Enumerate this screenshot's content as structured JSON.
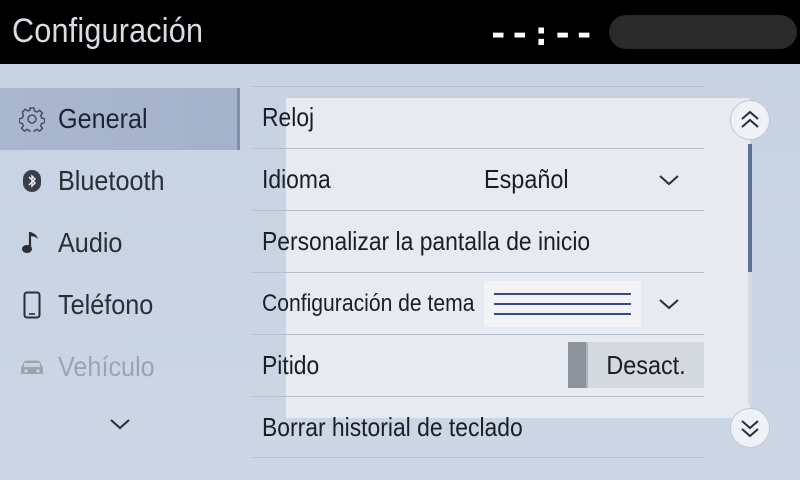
{
  "header": {
    "title": "Configuración",
    "clock": "--:--"
  },
  "sidebar": {
    "items": [
      {
        "label": "General",
        "icon": "gear-icon",
        "active": true
      },
      {
        "label": "Bluetooth",
        "icon": "bluetooth-icon"
      },
      {
        "label": "Audio",
        "icon": "music-note-icon"
      },
      {
        "label": "Teléfono",
        "icon": "phone-icon"
      },
      {
        "label": "Vehículo",
        "icon": "car-icon",
        "disabled": true
      }
    ],
    "more_icon": "chevron-down-icon"
  },
  "settings": {
    "rows": [
      {
        "label": "Reloj"
      },
      {
        "label": "Idioma",
        "value": "Español"
      },
      {
        "label": "Personalizar la pantalla de inicio"
      },
      {
        "label": "Configuración de tema"
      },
      {
        "label": "Pitido",
        "toggle": "Desact."
      },
      {
        "label": "Borrar historial de teclado"
      }
    ]
  },
  "scroll": {
    "up_icon": "double-chevron-up-icon",
    "down_icon": "double-chevron-down-icon",
    "position": 0
  },
  "colors": {
    "header_bg": "#000000",
    "active_item": "#a3b2ca",
    "accent": "#3b4a82",
    "scroll_thumb": "#5f7096"
  }
}
